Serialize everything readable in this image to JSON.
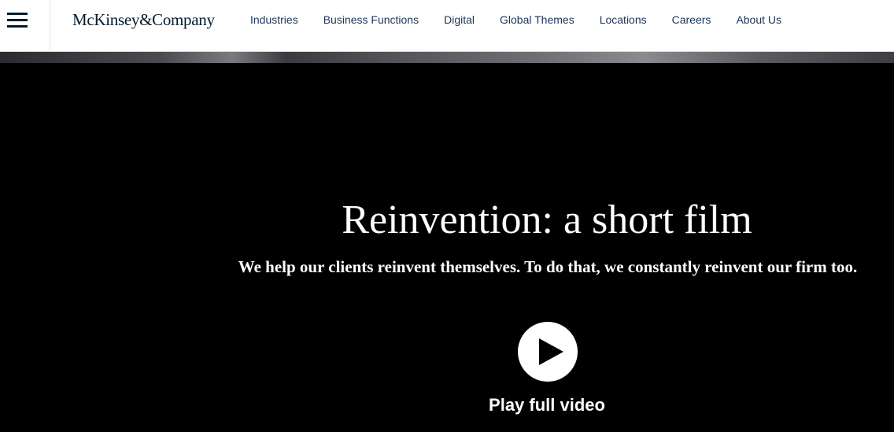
{
  "header": {
    "logo": "McKinsey&Company",
    "menu_icon": "hamburger-menu-icon",
    "nav": [
      {
        "label": "Industries"
      },
      {
        "label": "Business Functions"
      },
      {
        "label": "Digital"
      },
      {
        "label": "Global Themes"
      },
      {
        "label": "Locations"
      },
      {
        "label": "Careers"
      },
      {
        "label": "About Us"
      }
    ]
  },
  "hero": {
    "title": "Reinvention: a short film",
    "subtitle": "We help our clients reinvent themselves. To do that, we constantly reinvent our firm too.",
    "play_icon": "play-icon",
    "play_label": "Play full video"
  },
  "colors": {
    "brand_navy": "#051c2c",
    "nav_text": "#1a3557",
    "hero_bg": "#000000",
    "hero_text": "#ffffff"
  }
}
